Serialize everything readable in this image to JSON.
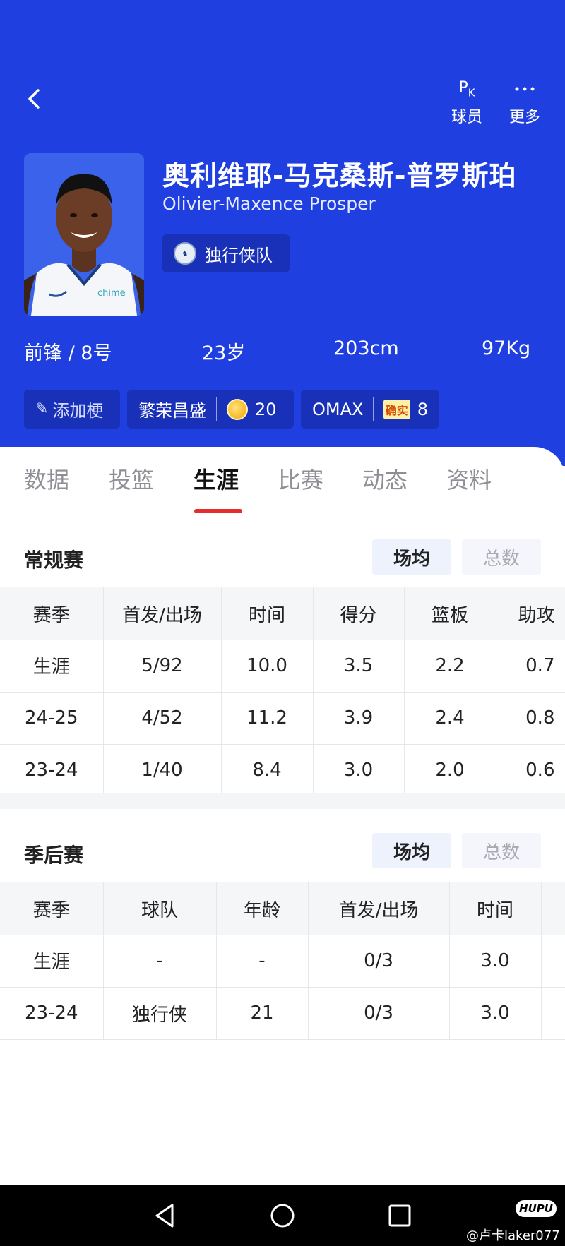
{
  "header": {
    "pk_label": "球员",
    "more_label": "更多",
    "name_cn": "奥利维耶-马克桑斯-普罗斯珀",
    "name_en": "Olivier-Maxence Prosper",
    "team": "独行侠队",
    "position_number": "前锋 / 8号",
    "age": "23岁",
    "height": "203cm",
    "weight": "97Kg",
    "tags": {
      "add_label": "添加梗",
      "fan_label": "繁荣昌盛",
      "fan_count": "20",
      "omax_label": "OMAX",
      "verify_badge": "确实",
      "omax_count": "8"
    },
    "colors": {
      "header_bg": "#1f3fe0",
      "tab_indicator": "#e52d2d"
    }
  },
  "tabs": [
    "数据",
    "投篮",
    "生涯",
    "比赛",
    "动态",
    "资料"
  ],
  "active_tab": "生涯",
  "regular_season": {
    "title": "常规赛",
    "toggle_avg": "场均",
    "toggle_total": "总数",
    "columns": [
      "赛季",
      "首发/出场",
      "时间",
      "得分",
      "篮板",
      "助攻"
    ],
    "rows": [
      [
        "生涯",
        "5/92",
        "10.0",
        "3.5",
        "2.2",
        "0.7"
      ],
      [
        "24-25",
        "4/52",
        "11.2",
        "3.9",
        "2.4",
        "0.8"
      ],
      [
        "23-24",
        "1/40",
        "8.4",
        "3.0",
        "2.0",
        "0.6"
      ]
    ]
  },
  "playoffs": {
    "title": "季后赛",
    "toggle_avg": "场均",
    "toggle_total": "总数",
    "columns": [
      "赛季",
      "球队",
      "年龄",
      "首发/出场",
      "时间",
      ""
    ],
    "rows": [
      [
        "生涯",
        "-",
        "-",
        "0/3",
        "3.0",
        ""
      ],
      [
        "23-24",
        "独行侠",
        "21",
        "0/3",
        "3.0",
        ""
      ]
    ]
  },
  "watermark": {
    "logo": "HUPU",
    "text": "@卢卡laker077"
  }
}
